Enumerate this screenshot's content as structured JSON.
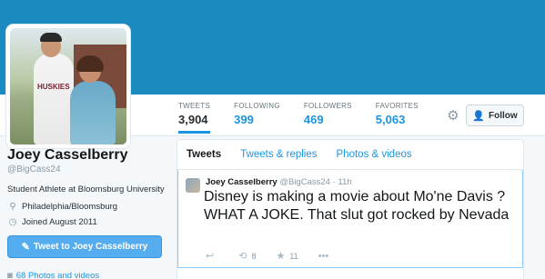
{
  "stats": [
    {
      "label": "TWEETS",
      "value": "3,904"
    },
    {
      "label": "FOLLOWING",
      "value": "399"
    },
    {
      "label": "FOLLOWERS",
      "value": "469"
    },
    {
      "label": "FAVORITES",
      "value": "5,063"
    }
  ],
  "actions": {
    "follow_label": "Follow"
  },
  "profile": {
    "name": "Joey Casselberry",
    "handle": "@BigCass24",
    "bio": "Student Athlete at Bloomsburg University",
    "location": "Philadelphia/Bloomsburg",
    "joined": "Joined August 2011",
    "tweet_to_label": "Tweet to Joey Casselberry",
    "photos_label": "68 Photos and videos"
  },
  "avatar": {
    "jersey_text": "HUSKIES"
  },
  "tabs": [
    {
      "label": "Tweets"
    },
    {
      "label": "Tweets & replies"
    },
    {
      "label": "Photos & videos"
    }
  ],
  "tweet": {
    "name": "Joey Casselberry",
    "handle": "@BigCass24",
    "time": "11h",
    "text": "Disney is making a movie about Mo'ne Davis ? WHAT A JOKE. That slut got rocked by Nevada",
    "retweets": "8",
    "favorites": "11"
  },
  "icons": {
    "gear": "gear-icon",
    "follow": "person-plus-icon",
    "location": "location-pin-icon",
    "calendar": "calendar-icon",
    "compose": "compose-icon",
    "camera": "camera-icon",
    "reply": "reply-icon",
    "retweet": "retweet-icon",
    "favorite": "star-icon",
    "more": "more-icon"
  },
  "colors": {
    "banner": "#1a8ac0",
    "accent": "#1b95e0",
    "button": "#55acee"
  }
}
